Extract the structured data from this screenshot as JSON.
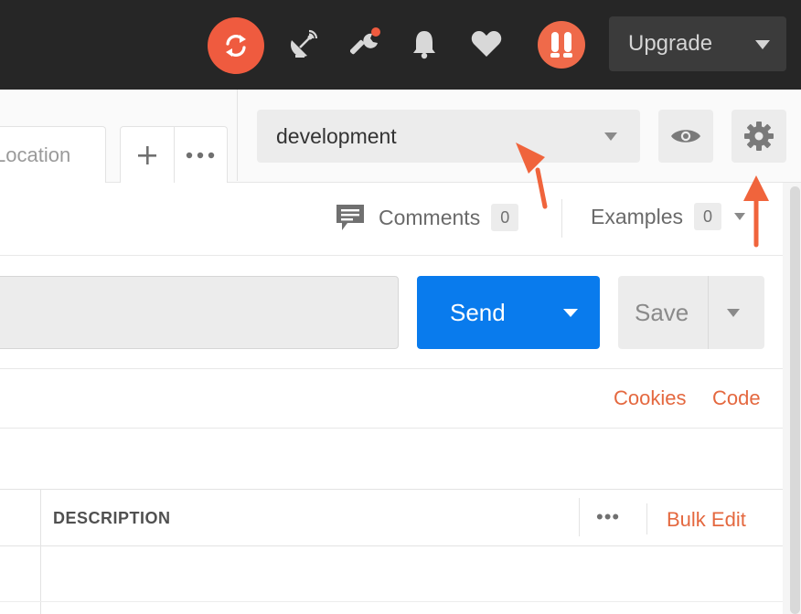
{
  "header": {
    "icons": [
      "sync-icon",
      "satellite-icon",
      "wrench-icon",
      "bell-icon",
      "heart-icon"
    ],
    "upgrade_label": "Upgrade",
    "avatar_icon": "user-avatar-icon",
    "accent_color": "#ef5b3f"
  },
  "tabs": {
    "partial_tab_label": "Location",
    "add_tab_icon": "plus-icon",
    "more_tabs_icon": "ellipsis-icon"
  },
  "environment": {
    "selected": "development",
    "quick_look_icon": "eye-icon",
    "manage_icon": "gear-icon"
  },
  "request_meta": {
    "comments_label": "Comments",
    "comments_count": "0",
    "examples_label": "Examples",
    "examples_count": "0"
  },
  "request_bar": {
    "send_label": "Send",
    "save_label": "Save",
    "send_color": "#097bed"
  },
  "links": {
    "cookies": "Cookies",
    "code": "Code",
    "link_color": "#e4683f"
  },
  "params_table": {
    "columns": [
      "DESCRIPTION"
    ],
    "more_label": "•••",
    "bulk_edit_label": "Bulk Edit"
  },
  "annotations": {
    "arrow_color": "#f0643c"
  }
}
